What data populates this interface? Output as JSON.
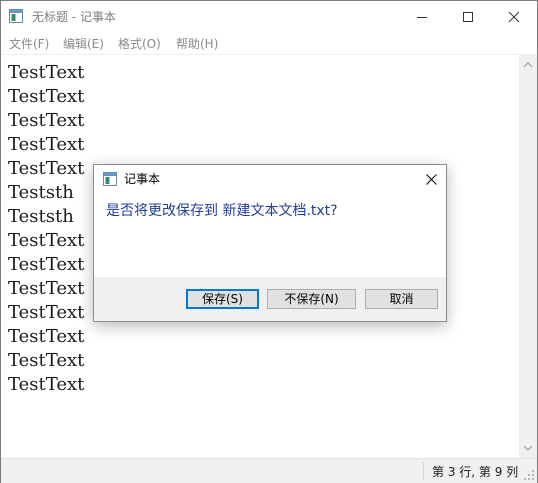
{
  "window": {
    "title": "无标题 - 记事本"
  },
  "menu": {
    "items": [
      "文件(F)",
      "编辑(E)",
      "格式(O)",
      "帮助(H)"
    ]
  },
  "editor": {
    "lines": [
      "TestText",
      "TestText",
      "TestText",
      "TestText",
      "TestText",
      "Teststh",
      "Teststh",
      "TestText",
      "TestText",
      "TestText",
      "TestText",
      "TestText",
      "TestText",
      "TestText"
    ]
  },
  "status": {
    "position": "第 3 行, 第 9 列"
  },
  "dialog": {
    "title": "记事本",
    "message": "是否将更改保存到 新建文本文档.txt?",
    "buttons": {
      "save": "保存(S)",
      "dont_save": "不保存(N)",
      "cancel": "取消"
    }
  },
  "icons": {
    "app": "notepad-icon",
    "minimize": "minimize-icon",
    "maximize": "maximize-icon",
    "close": "close-icon",
    "scroll_up": "scroll-up-arrow-icon",
    "scroll_down": "scroll-down-arrow-icon",
    "grip": "resize-grip-icon"
  },
  "colors": {
    "dialog_message": "#1e3e9c",
    "default_button_border": "#0078d7"
  }
}
